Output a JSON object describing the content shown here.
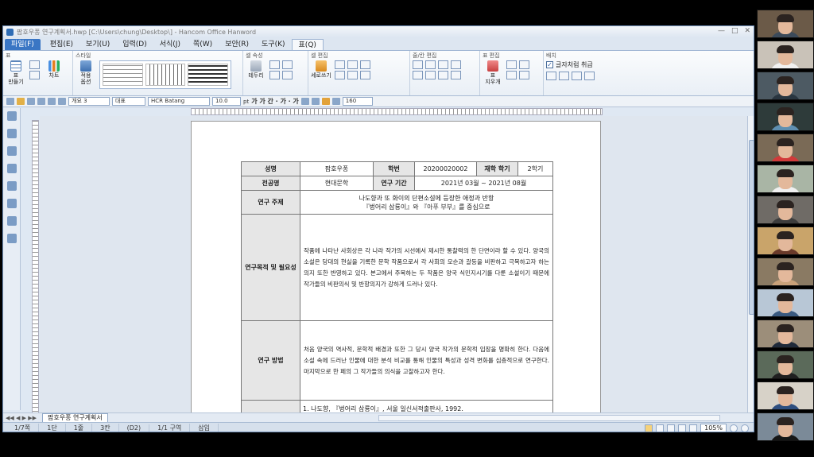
{
  "window": {
    "title": "팜호우퐁 연구계획서.hwp [C:\\Users\\chung\\Desktop\\] - Hancom Office Hanword",
    "controls": [
      "—",
      "□",
      "✕"
    ]
  },
  "menu": [
    {
      "label": "파일(F)",
      "key": "file"
    },
    {
      "label": "편집(E)",
      "key": "edit"
    },
    {
      "label": "보기(U)",
      "key": "view"
    },
    {
      "label": "입력(D)",
      "key": "insert"
    },
    {
      "label": "서식(J)",
      "key": "format"
    },
    {
      "label": "쪽(W)",
      "key": "page"
    },
    {
      "label": "보안(R)",
      "key": "security"
    },
    {
      "label": "도구(K)",
      "key": "tools"
    },
    {
      "label": "표(Q)",
      "key": "table"
    }
  ],
  "ribbon": {
    "groups": {
      "table": "표",
      "style": "스타일",
      "cell_props": "셀 속성",
      "cell_edit": "셀 편집",
      "rowcol_edit": "줄/칸 편집",
      "table_edit": "표 편집",
      "layout": "배치"
    },
    "buttons": {
      "table_make": "표\n만들기",
      "chart": "차트",
      "apply_options": "적용\n옵션",
      "border": "테두리",
      "vertical_text": "세로쓰기",
      "eraser": "표\n지우개",
      "treat_as_char": "글자처럼 취급"
    }
  },
  "formatbar": {
    "style": "개요 3",
    "font_class": "대표",
    "font": "HCR Batang",
    "size": "10.0",
    "size_unit": "pt",
    "weight_labels": "가 가 간 · 가 · 가",
    "zoom": "160"
  },
  "document": {
    "rows": {
      "name_label": "성명",
      "name_value": "팜호우퐁",
      "id_label": "학번",
      "id_value": "20200020002",
      "semester_label": "재학 학기",
      "semester_value": "2학기",
      "major_label": "전공명",
      "major_value": "현대문학",
      "period_label": "연구 기간",
      "period_value": "2021년 03월 ~ 2021년 08월",
      "topic_label": "연구 주제",
      "topic_line1": "나도향과 또 화이의 단편소설에 등장한 애정과 반항",
      "topic_line2": "『벙어리 삼룡이』와 『아푸 부부』를 중심으로",
      "purpose_label": "연구목적 및 필요성",
      "purpose_text": "작품에 나타난 사회상은 각 나라 작가의 시선에서 제시한 통찰력의 한 단면이라 할 수 있다. 양국의 소설은 당대의 현실을 기록한 문학 작품으로서 각 사회의 모순과 갈등을 비판하고 극복하고자 하는 의지 또한 반영하고 있다. 본고에서 주목하는 두 작품은 양국 식민지시기를 다룬 소설이기 때문에 작가들의 비판의식 및 반항의지가 강하게 드러나 있다.",
      "method_label": "연구 방법",
      "method_text": "처음 양국의 역사적, 문학적 배경과 또한 그 당시 양국 작가의 문학적 입장을 명확히 한다. 다음에 소설 속에 드러난 인물에 대한 분석 비교를 통해 인물의 특성과 성격 변화를 심층적으로 연구한다. 마지막으로 한 페의 그 작가들의 의식을 고찰하고자 한다.",
      "reference_line": "1. 나도향, 『벙어리 삼룡이』, 서울 일신서적출판사, 1992."
    }
  },
  "tabs": {
    "nav": "◀◀ ◀ ▶ ▶▶",
    "doc_tab": "팜호우퐁 연구계획서"
  },
  "status": {
    "page": "1/7쪽",
    "section": "1단",
    "line": "1줄",
    "column": "3칸",
    "mode_code": "(D2)",
    "zone": "1/1 구역",
    "insert_mode": "삽입",
    "zoom": "105%"
  },
  "participants": [
    {
      "bg": "#6b5a48",
      "shirt": "#3c4a5a"
    },
    {
      "bg": "#c9c2b8",
      "shirt": "#f1f1f1"
    },
    {
      "bg": "#4d5a63",
      "shirt": "#2a3640"
    },
    {
      "bg": "#2e3b3a",
      "shirt": "#5f8fb1"
    },
    {
      "bg": "#7a6a56",
      "shirt": "#d13a3a"
    },
    {
      "bg": "#a9b5a5",
      "shirt": "#f0f0f0"
    },
    {
      "bg": "#6f6b66",
      "shirt": "#3d3d3d"
    },
    {
      "bg": "#c9a46a",
      "shirt": "#6a3a2a"
    },
    {
      "bg": "#8a7a63",
      "shirt": "#caa27a"
    },
    {
      "bg": "#b8c7d6",
      "shirt": "#3a5a80"
    },
    {
      "bg": "#9c8e7a",
      "shirt": "#1f2a3a"
    },
    {
      "bg": "#5b6a5a",
      "shirt": "#202020"
    },
    {
      "bg": "#d7d2c8",
      "shirt": "#2f4f7f"
    },
    {
      "bg": "#7b8a98",
      "shirt": "#161616"
    }
  ]
}
